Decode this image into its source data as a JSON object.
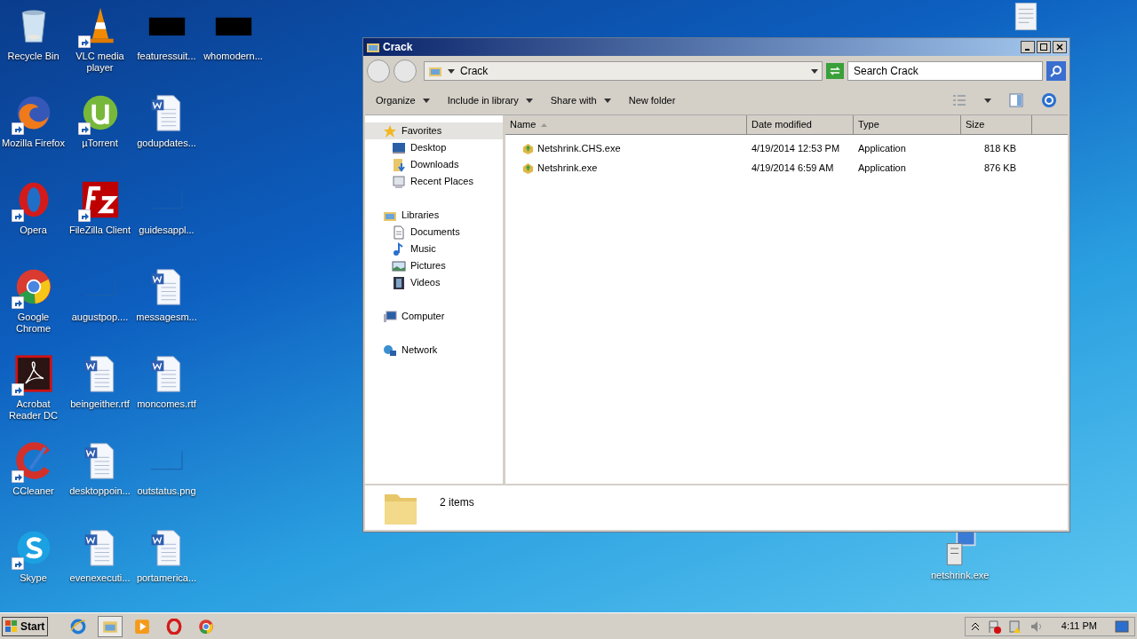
{
  "desktop_icons": [
    [
      {
        "label": "Recycle Bin",
        "kind": "recycle",
        "shortcut": false
      },
      {
        "label": "Mozilla Firefox",
        "kind": "firefox",
        "shortcut": true
      },
      {
        "label": "Opera",
        "kind": "opera",
        "shortcut": true
      },
      {
        "label": "Google Chrome",
        "kind": "chrome",
        "shortcut": true
      },
      {
        "label": "Acrobat Reader DC",
        "kind": "acrobat",
        "shortcut": true
      },
      {
        "label": "CCleaner",
        "kind": "ccleaner",
        "shortcut": true
      },
      {
        "label": "Skype",
        "kind": "skype",
        "shortcut": true
      }
    ],
    [
      {
        "label": "VLC media player",
        "kind": "vlc",
        "shortcut": true
      },
      {
        "label": "µTorrent",
        "kind": "utorrent",
        "shortcut": true
      },
      {
        "label": "FileZilla Client",
        "kind": "filezilla",
        "shortcut": true
      },
      {
        "label": "augustpop....",
        "kind": "blank",
        "shortcut": false
      },
      {
        "label": "beingeither.rtf",
        "kind": "word",
        "shortcut": false
      },
      {
        "label": "desktoppoin...",
        "kind": "word",
        "shortcut": false
      },
      {
        "label": "evenexecuti...",
        "kind": "word",
        "shortcut": false
      }
    ],
    [
      {
        "label": "featuressuit...",
        "kind": "black",
        "shortcut": false
      },
      {
        "label": "godupdates...",
        "kind": "word",
        "shortcut": false
      },
      {
        "label": "guidesappl...",
        "kind": "blank",
        "shortcut": false
      },
      {
        "label": "messagesm...",
        "kind": "word",
        "shortcut": false
      },
      {
        "label": "moncomes.rtf",
        "kind": "word",
        "shortcut": false
      },
      {
        "label": "outstatus.png",
        "kind": "blank",
        "shortcut": false
      },
      {
        "label": "portamerica...",
        "kind": "word",
        "shortcut": false
      }
    ],
    [
      {
        "label": "whomodern...",
        "kind": "black",
        "shortcut": false
      }
    ]
  ],
  "floating_icons": [
    {
      "kind": "thumbnail"
    },
    {
      "kind": "installer",
      "label": "netshrink.exe"
    }
  ],
  "window": {
    "title": "Crack",
    "address": "Crack",
    "search": {
      "placeholder": "Search Crack"
    },
    "toolbar": [
      {
        "label": "Organize",
        "dropdown": true
      },
      {
        "label": "Include in library",
        "dropdown": true
      },
      {
        "label": "Share with",
        "dropdown": true
      },
      {
        "label": "New folder",
        "dropdown": false
      }
    ],
    "sidebar": [
      {
        "label": "Favorites",
        "kind": "favorites",
        "selected": true,
        "children": [
          {
            "label": "Desktop",
            "kind": "desktop",
            "selected": false
          },
          {
            "label": "Downloads",
            "kind": "downloads",
            "selected": false
          },
          {
            "label": "Recent Places",
            "kind": "recent",
            "selected": false
          }
        ]
      },
      {
        "label": "Libraries",
        "kind": "libraries",
        "selected": false,
        "children": [
          {
            "label": "Documents",
            "kind": "documents",
            "selected": false
          },
          {
            "label": "Music",
            "kind": "music",
            "selected": false
          },
          {
            "label": "Pictures",
            "kind": "pictures",
            "selected": false
          },
          {
            "label": "Videos",
            "kind": "videos",
            "selected": false
          }
        ]
      },
      {
        "label": "Computer",
        "kind": "computer",
        "selected": false
      },
      {
        "label": "Network",
        "kind": "network",
        "selected": false
      }
    ],
    "columns": [
      "Name",
      "Date modified",
      "Type",
      "Size"
    ],
    "rows": [
      [
        "Netshrink.CHS.exe",
        "4/19/2014 12:53 PM",
        "Application",
        "818 KB"
      ],
      [
        "Netshrink.exe",
        "4/19/2014 6:59 AM",
        "Application",
        "876 KB"
      ]
    ],
    "status": "2 items"
  },
  "taskbar": {
    "start": "Start",
    "apps": [
      {
        "kind": "ie",
        "selected": false
      },
      {
        "kind": "explorer",
        "selected": true
      },
      {
        "kind": "media",
        "selected": false
      },
      {
        "kind": "opera",
        "selected": false
      },
      {
        "kind": "chrome",
        "selected": false
      }
    ],
    "time": "4:11 PM"
  }
}
